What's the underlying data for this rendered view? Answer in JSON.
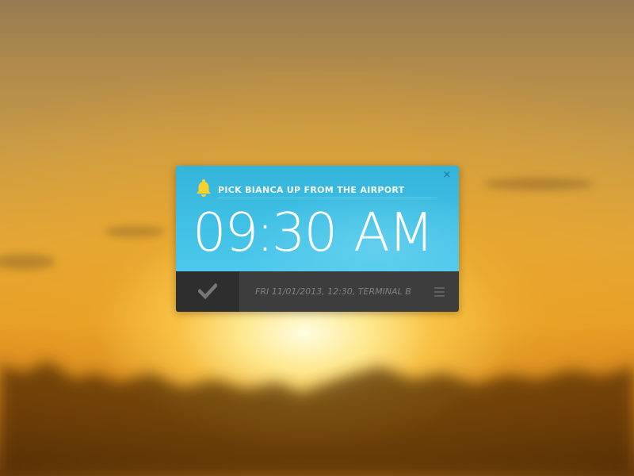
{
  "widget": {
    "title": "PICK BIANCA UP FROM THE AIRPORT",
    "time": {
      "hours": "09",
      "separator": ":",
      "minutes": "30",
      "period": "AM"
    },
    "details": "FRI 11/01/2013, 12:30, TERMINAL B",
    "close_label": "×",
    "icons": {
      "bell": "bell-icon",
      "close": "close-icon",
      "check": "checkmark-icon",
      "menu": "hamburger-menu-icon"
    },
    "colors": {
      "accent": "#41c0e5",
      "bell": "#f6d22c",
      "footer": "#3d3d3d",
      "check_button": "#2e2e2e"
    }
  }
}
